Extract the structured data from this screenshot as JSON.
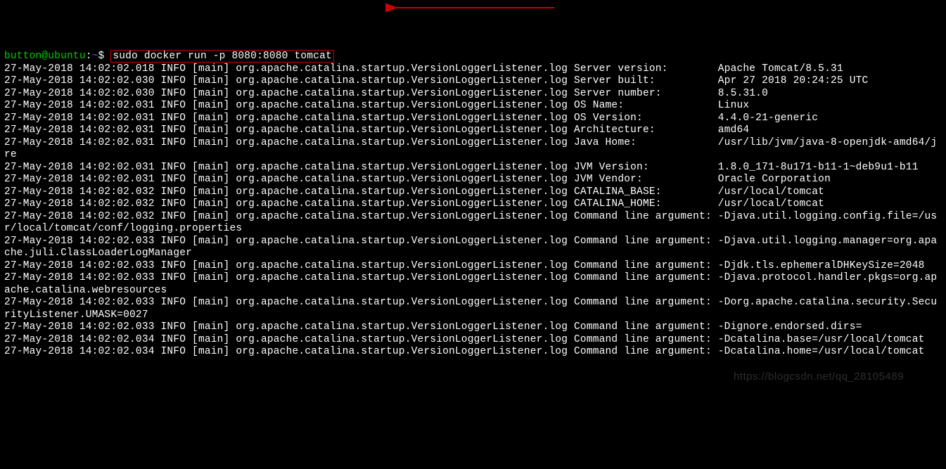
{
  "prompt": {
    "user": "button@ubuntu",
    "colon": ":",
    "path": "~",
    "dollar": "$ ",
    "command": "sudo docker run -p 8080:8080 tomcat"
  },
  "lines": [
    "27-May-2018 14:02:02.018 INFO [main] org.apache.catalina.startup.VersionLoggerListener.log Server version:        Apache Tomcat/8.5.31",
    "27-May-2018 14:02:02.030 INFO [main] org.apache.catalina.startup.VersionLoggerListener.log Server built:          Apr 27 2018 20:24:25 UTC",
    "27-May-2018 14:02:02.030 INFO [main] org.apache.catalina.startup.VersionLoggerListener.log Server number:         8.5.31.0",
    "27-May-2018 14:02:02.031 INFO [main] org.apache.catalina.startup.VersionLoggerListener.log OS Name:               Linux",
    "27-May-2018 14:02:02.031 INFO [main] org.apache.catalina.startup.VersionLoggerListener.log OS Version:            4.4.0-21-generic",
    "27-May-2018 14:02:02.031 INFO [main] org.apache.catalina.startup.VersionLoggerListener.log Architecture:          amd64",
    "27-May-2018 14:02:02.031 INFO [main] org.apache.catalina.startup.VersionLoggerListener.log Java Home:             /usr/lib/jvm/java-8-openjdk-amd64/jre",
    "27-May-2018 14:02:02.031 INFO [main] org.apache.catalina.startup.VersionLoggerListener.log JVM Version:           1.8.0_171-8u171-b11-1~deb9u1-b11",
    "27-May-2018 14:02:02.031 INFO [main] org.apache.catalina.startup.VersionLoggerListener.log JVM Vendor:            Oracle Corporation",
    "27-May-2018 14:02:02.032 INFO [main] org.apache.catalina.startup.VersionLoggerListener.log CATALINA_BASE:         /usr/local/tomcat",
    "27-May-2018 14:02:02.032 INFO [main] org.apache.catalina.startup.VersionLoggerListener.log CATALINA_HOME:         /usr/local/tomcat",
    "27-May-2018 14:02:02.032 INFO [main] org.apache.catalina.startup.VersionLoggerListener.log Command line argument: -Djava.util.logging.config.file=/usr/local/tomcat/conf/logging.properties",
    "27-May-2018 14:02:02.033 INFO [main] org.apache.catalina.startup.VersionLoggerListener.log Command line argument: -Djava.util.logging.manager=org.apache.juli.ClassLoaderLogManager",
    "27-May-2018 14:02:02.033 INFO [main] org.apache.catalina.startup.VersionLoggerListener.log Command line argument: -Djdk.tls.ephemeralDHKeySize=2048",
    "27-May-2018 14:02:02.033 INFO [main] org.apache.catalina.startup.VersionLoggerListener.log Command line argument: -Djava.protocol.handler.pkgs=org.apache.catalina.webresources",
    "27-May-2018 14:02:02.033 INFO [main] org.apache.catalina.startup.VersionLoggerListener.log Command line argument: -Dorg.apache.catalina.security.SecurityListener.UMASK=0027",
    "27-May-2018 14:02:02.033 INFO [main] org.apache.catalina.startup.VersionLoggerListener.log Command line argument: -Dignore.endorsed.dirs=",
    "27-May-2018 14:02:02.034 INFO [main] org.apache.catalina.startup.VersionLoggerListener.log Command line argument: -Dcatalina.base=/usr/local/tomcat",
    "27-May-2018 14:02:02.034 INFO [main] org.apache.catalina.startup.VersionLoggerListener.log Command line argument: -Dcatalina.home=/usr/local/tomcat"
  ],
  "watermark": "https://blogcsdn.net/qq_28105489"
}
